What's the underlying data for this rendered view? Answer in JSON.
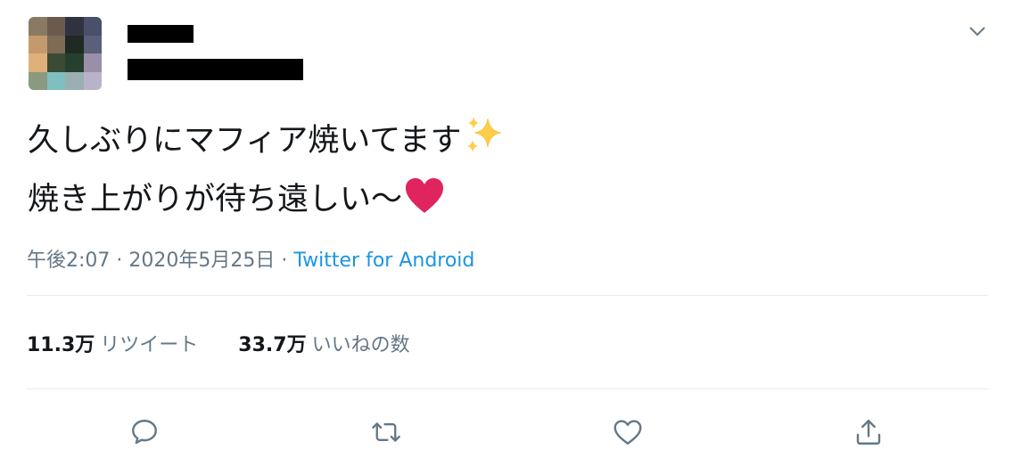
{
  "tweet": {
    "lines": [
      "久しぶりにマフィア焼いてます",
      "焼き上がりが待ち遠しい〜"
    ],
    "emoji": [
      "sparkles-emoji",
      "red-heart-emoji"
    ]
  },
  "meta": {
    "time": "午後2:07",
    "sep1": " · ",
    "date": "2020年5月25日",
    "sep2": " · ",
    "source": "Twitter for Android"
  },
  "stats": {
    "retweets_count": "11.3万",
    "retweets_label": "リツイート",
    "likes_count": "33.7万",
    "likes_label": "いいねの数"
  },
  "icons": [
    "chevron-down-icon",
    "reply-icon",
    "retweet-icon",
    "like-icon",
    "share-icon"
  ],
  "colors": {
    "text": "#14171a",
    "secondary": "#657786",
    "link": "#1b95e0",
    "divider": "#e6ecf0",
    "heart": "#e0245e",
    "sparkle": "#ffcc4d"
  }
}
